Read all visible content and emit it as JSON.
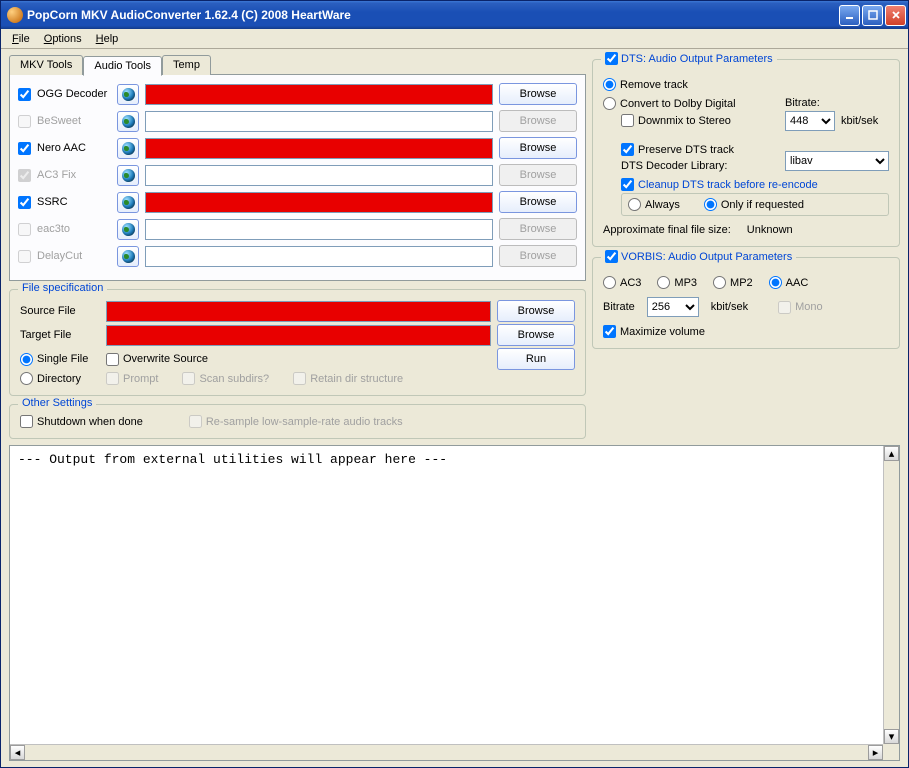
{
  "window": {
    "title": "PopCorn MKV AudioConverter 1.62.4 (C) 2008 HeartWare"
  },
  "menu": {
    "file": "File",
    "options": "Options",
    "help": "Help"
  },
  "tabs": {
    "mkv": "MKV Tools",
    "audio": "Audio Tools",
    "temp": "Temp"
  },
  "tools": [
    {
      "name": "OGG Decoder",
      "enabled": true,
      "invalid": true,
      "browse_enabled": true
    },
    {
      "name": "BeSweet",
      "enabled": false,
      "invalid": false,
      "browse_enabled": false
    },
    {
      "name": "Nero AAC",
      "enabled": true,
      "invalid": true,
      "browse_enabled": true
    },
    {
      "name": "AC3 Fix",
      "enabled": false,
      "invalid": false,
      "browse_enabled": false,
      "checked": true
    },
    {
      "name": "SSRC",
      "enabled": true,
      "invalid": true,
      "browse_enabled": true
    },
    {
      "name": "eac3to",
      "enabled": false,
      "invalid": false,
      "browse_enabled": false
    },
    {
      "name": "DelayCut",
      "enabled": false,
      "invalid": false,
      "browse_enabled": false
    }
  ],
  "browse_label": "Browse",
  "filespec": {
    "legend": "File specification",
    "source": "Source File",
    "target": "Target File",
    "single": "Single File",
    "directory": "Directory",
    "overwrite": "Overwrite Source",
    "prompt": "Prompt",
    "scan": "Scan subdirs?",
    "retain": "Retain dir structure",
    "run": "Run"
  },
  "other": {
    "legend": "Other Settings",
    "shutdown": "Shutdown when done",
    "resample": "Re-sample low-sample-rate audio tracks"
  },
  "dts": {
    "legend": "DTS: Audio Output Parameters",
    "remove": "Remove track",
    "convert": "Convert to Dolby Digital",
    "downmix": "Downmix to Stereo",
    "preserve": "Preserve DTS track",
    "decoder_lib": "DTS Decoder Library:",
    "decoder_value": "libav",
    "bitrate_label": "Bitrate:",
    "bitrate_value": "448",
    "bitrate_unit": "kbit/sek",
    "cleanup": "Cleanup DTS track before re-encode",
    "always": "Always",
    "only_req": "Only if requested",
    "approx": "Approximate final file size:",
    "size_value": "Unknown"
  },
  "vorbis": {
    "legend": "VORBIS: Audio Output Parameters",
    "ac3": "AC3",
    "mp3": "MP3",
    "mp2": "MP2",
    "aac": "AAC",
    "bitrate": "Bitrate",
    "bitrate_value": "256",
    "unit": "kbit/sek",
    "mono": "Mono",
    "maxvol": "Maximize volume"
  },
  "output": "--- Output from external utilities will appear here ---"
}
